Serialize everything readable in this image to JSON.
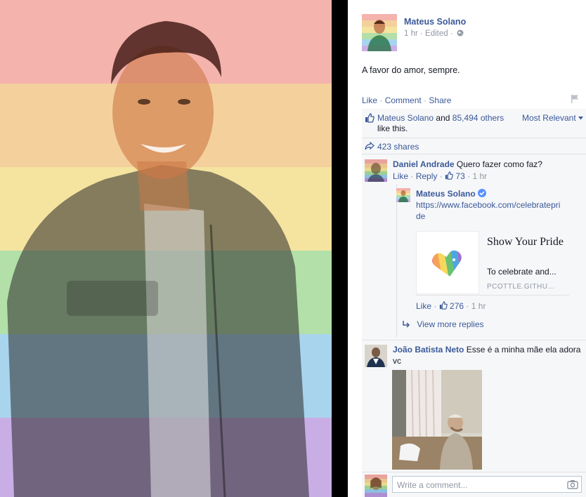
{
  "post": {
    "author": "Mateus Solano",
    "meta": "1 hr · Edited ·",
    "text": "A favor do amor, sempre.",
    "actions": {
      "like": "Like",
      "comment": "Comment",
      "share": "Share",
      "sep": "·"
    }
  },
  "feedback": {
    "likes_name": "Mateus Solano",
    "likes_and": "and",
    "likes_others": "85,494 others",
    "likes_tail": "like this.",
    "sort": "Most Relevant",
    "shares": "423 shares"
  },
  "comments": [
    {
      "author": "Daniel Andrade",
      "text": "Quero fazer como faz?",
      "like": "Like",
      "reply": "Reply",
      "likes": "73",
      "time": "1 hr"
    }
  ],
  "reply": {
    "author": "Mateus Solano",
    "url_line1": "https://www.facebook.com/celebratepri",
    "url_line2": "de",
    "card": {
      "title": "Show Your Pride",
      "desc": "To celebrate and...",
      "source": "PCOTTLE.GITHU..."
    },
    "like": "Like",
    "likes": "276",
    "time": "1 hr"
  },
  "view_more": "View more replies",
  "comment2": {
    "author": "João Batista Neto",
    "text": "Esse é a minha mãe ela adora vc"
  },
  "composer": {
    "placeholder": "Write a comment..."
  },
  "colors": {
    "link": "#3b5998",
    "meta": "#9197a3",
    "feedback_bg": "#f6f7f9",
    "rainbow": [
      "#f4a6a0",
      "#f6c98e",
      "#f8e48e",
      "#a9dd98",
      "#8fc8e8",
      "#b48fd8"
    ]
  },
  "icons": [
    "globe-icon",
    "flag-icon",
    "thumbs-up-icon",
    "share-arrow-icon",
    "reply-arrow-icon",
    "verified-icon",
    "heart-icon",
    "camera-icon",
    "chevron-down-icon"
  ]
}
